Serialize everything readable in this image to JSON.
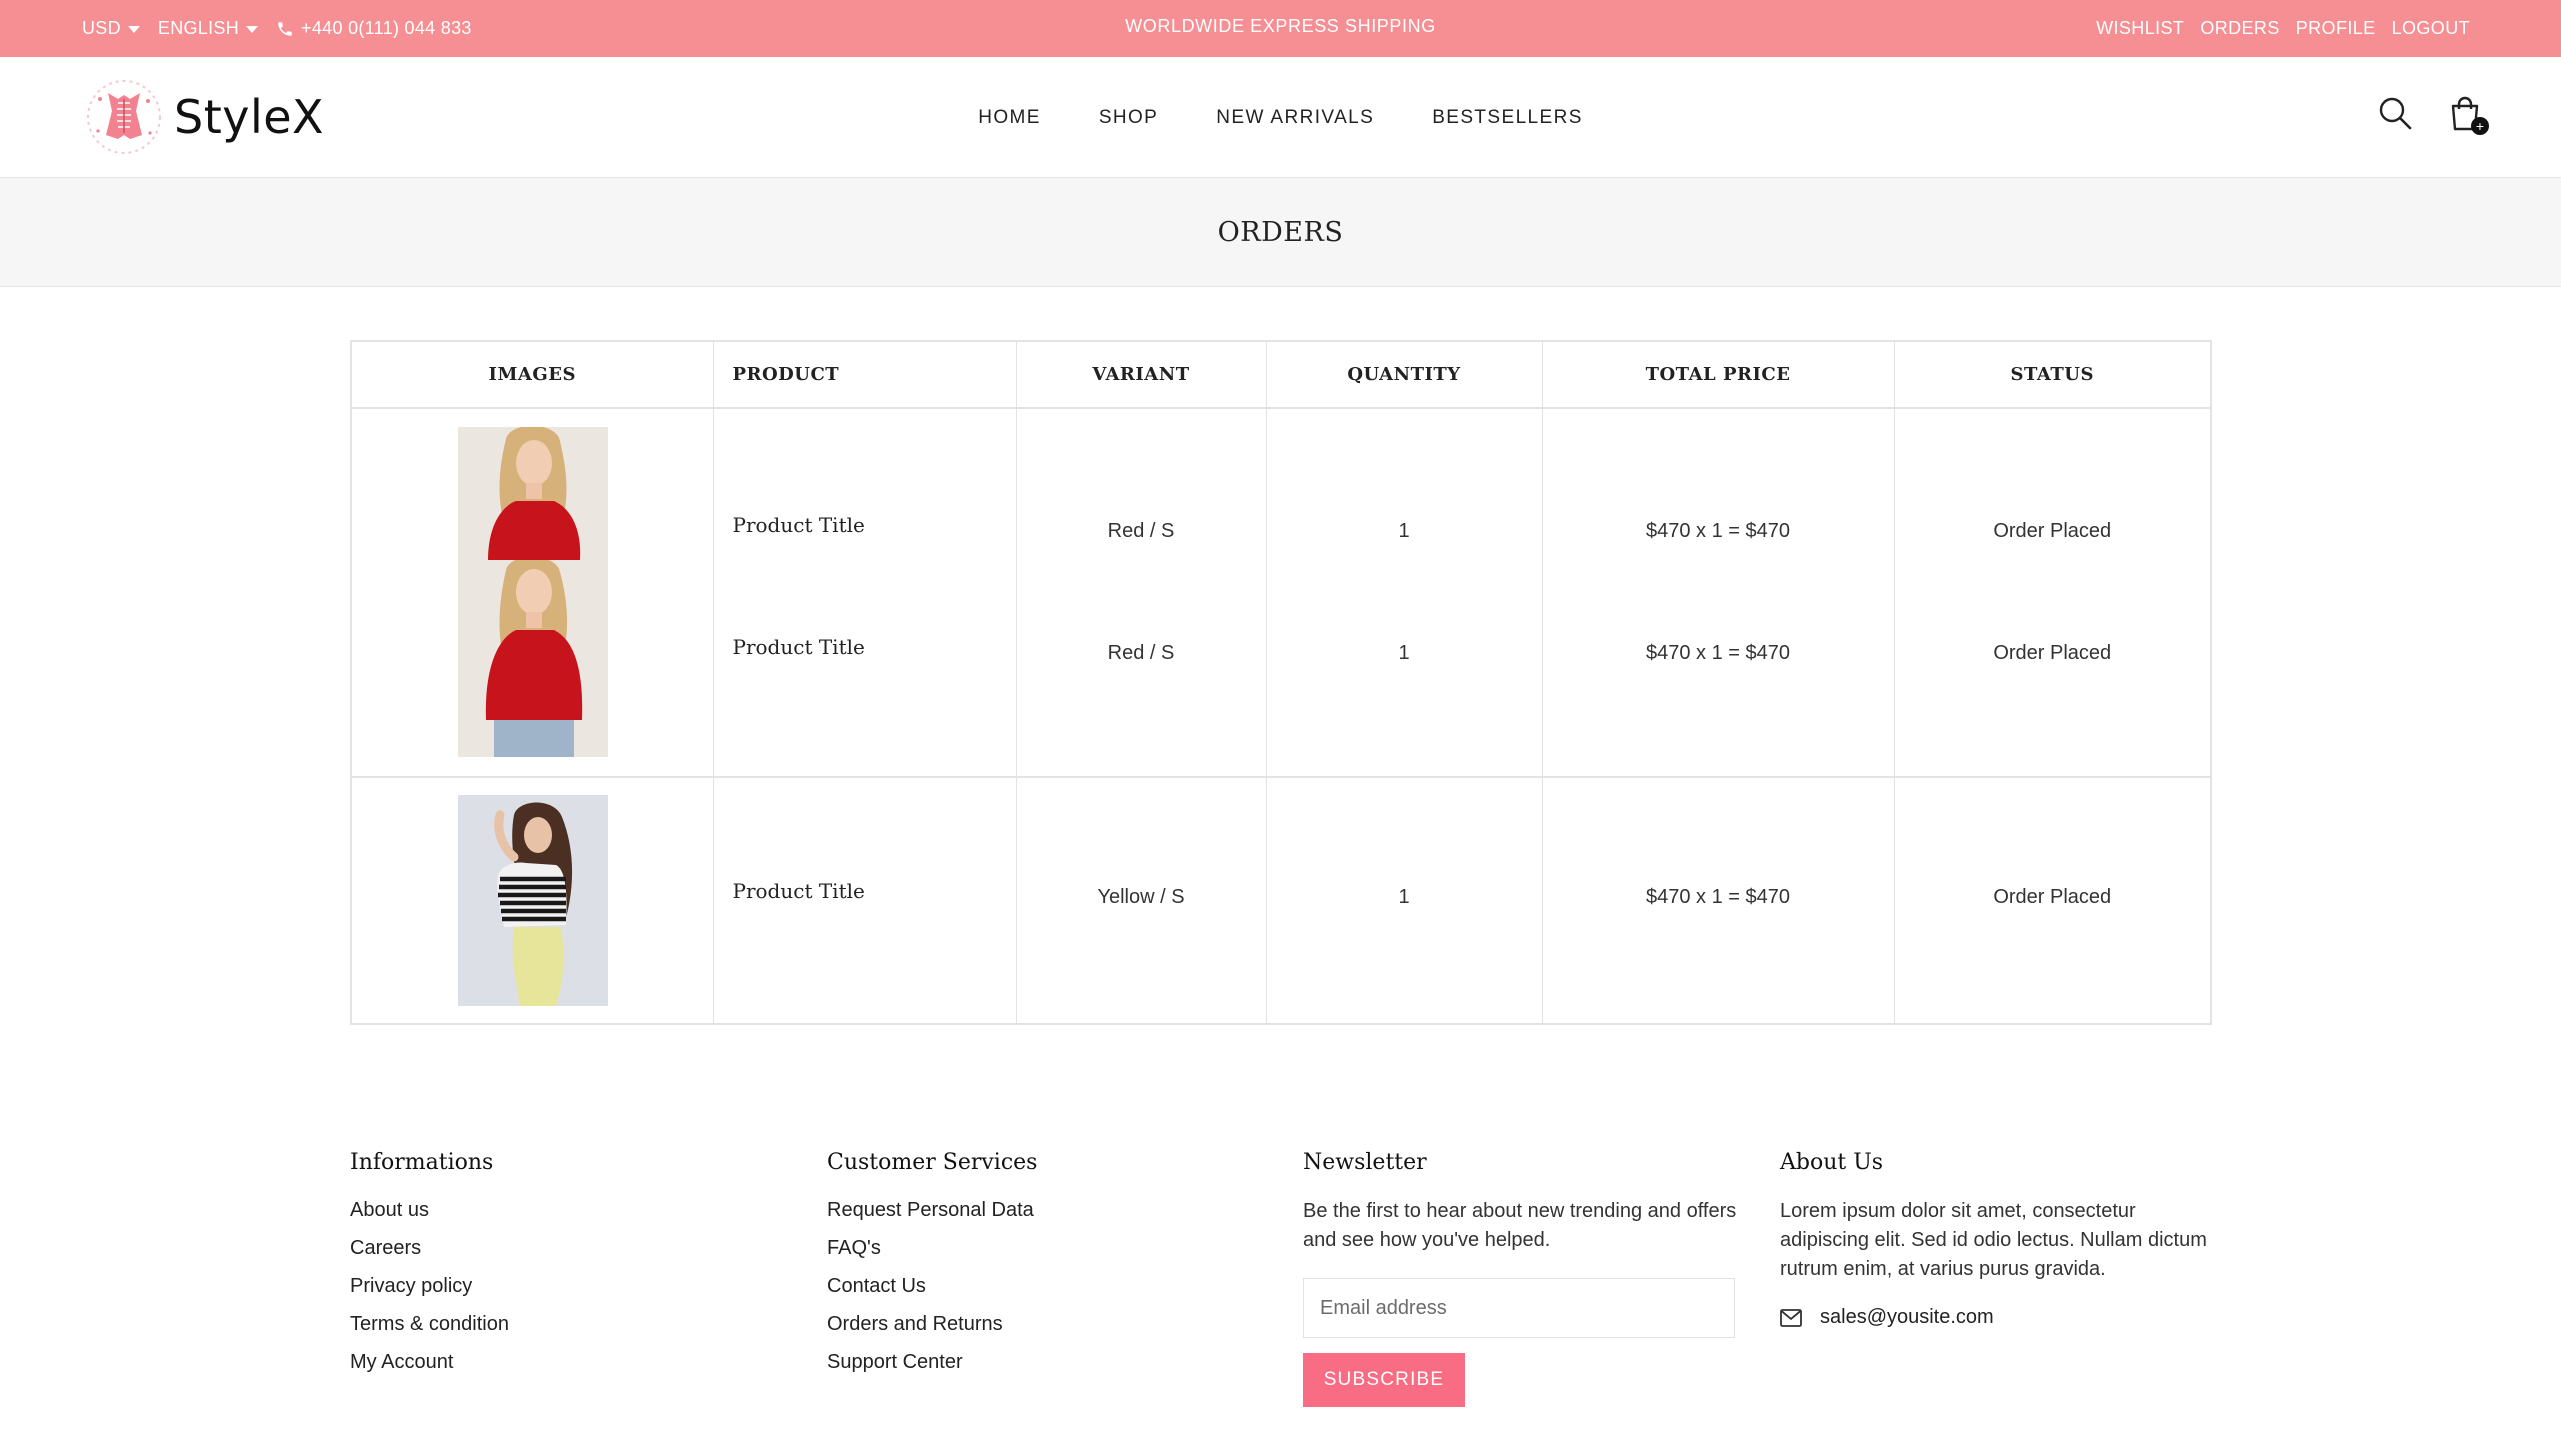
{
  "topbar": {
    "currency": "USD",
    "language": "ENGLISH",
    "phone": "+440 0(111) 044 833",
    "announcement": "WORLDWIDE EXPRESS SHIPPING",
    "links": [
      "WISHLIST",
      "ORDERS",
      "PROFILE",
      "LOGOUT"
    ],
    "bg_color": "#f58f94"
  },
  "header": {
    "brand": "StyleX",
    "nav": [
      "HOME",
      "SHOP",
      "NEW ARRIVALS",
      "BESTSELLERS"
    ],
    "icons": [
      "search-icon",
      "cart-icon"
    ],
    "cart_badge": "+"
  },
  "page": {
    "title": "ORDERS"
  },
  "orders_table": {
    "columns": [
      "IMAGES",
      "PRODUCT",
      "VARIANT",
      "QUANTITY",
      "TOTAL PRICE",
      "STATUS"
    ],
    "orders": [
      {
        "items": [
          {
            "product": "Product Title",
            "variant": "Red / S",
            "quantity": "1",
            "total": "$470 x 1 = $470",
            "status": "Order Placed",
            "image": "red-top-model"
          },
          {
            "product": "Product Title",
            "variant": "Red / S",
            "quantity": "1",
            "total": "$470 x 1 = $470",
            "status": "Order Placed",
            "image": "red-top-model"
          }
        ]
      },
      {
        "items": [
          {
            "product": "Product Title",
            "variant": "Yellow / S",
            "quantity": "1",
            "total": "$470 x 1 = $470",
            "status": "Order Placed",
            "image": "striped-top-model"
          }
        ]
      }
    ]
  },
  "footer": {
    "informations": {
      "title": "Informations",
      "links": [
        "About us",
        "Careers",
        "Privacy policy",
        "Terms & condition",
        "My Account"
      ]
    },
    "customer_services": {
      "title": "Customer Services",
      "links": [
        "Request Personal Data",
        "FAQ's",
        "Contact Us",
        "Orders and Returns",
        "Support Center"
      ]
    },
    "newsletter": {
      "title": "Newsletter",
      "text": "Be the first to hear about new trending and offers and see how you've helped.",
      "placeholder": "Email address",
      "button": "SUBSCRIBE",
      "button_color": "#f86d83"
    },
    "about": {
      "title": "About Us",
      "text": "Lorem ipsum dolor sit amet, consectetur adipiscing elit. Sed id odio lectus. Nullam dictum rutrum enim, at varius purus gravida.",
      "email": "sales@yousite.com"
    }
  }
}
